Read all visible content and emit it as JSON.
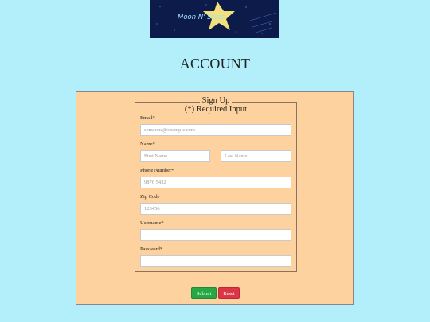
{
  "logo": {
    "text": "Moon N' Stars",
    "colors": {
      "background": "#0c1b4a",
      "moon": "#2ec4e6",
      "star": "#f2e07a"
    }
  },
  "page_title": "ACCOUNT",
  "form": {
    "legend_line1": "Sign Up",
    "legend_line2": "(*) Required Input",
    "email": {
      "label": "Email*",
      "placeholder": "someone@example.com"
    },
    "name": {
      "label": "Name*",
      "first_placeholder": "First Name",
      "last_placeholder": "Last Name"
    },
    "phone": {
      "label": "Phone Number*",
      "placeholder": "9876 5432"
    },
    "zip": {
      "label": "Zip Code",
      "placeholder": "123456"
    },
    "username": {
      "label": "Username*",
      "placeholder": ""
    },
    "password": {
      "label": "Password*",
      "placeholder": ""
    },
    "submit_label": "Submit",
    "reset_label": "Reset"
  },
  "colors": {
    "page_bg": "#b3eefb",
    "panel_bg": "#fdd29f",
    "submit": "#28a745",
    "reset": "#dc3545"
  }
}
